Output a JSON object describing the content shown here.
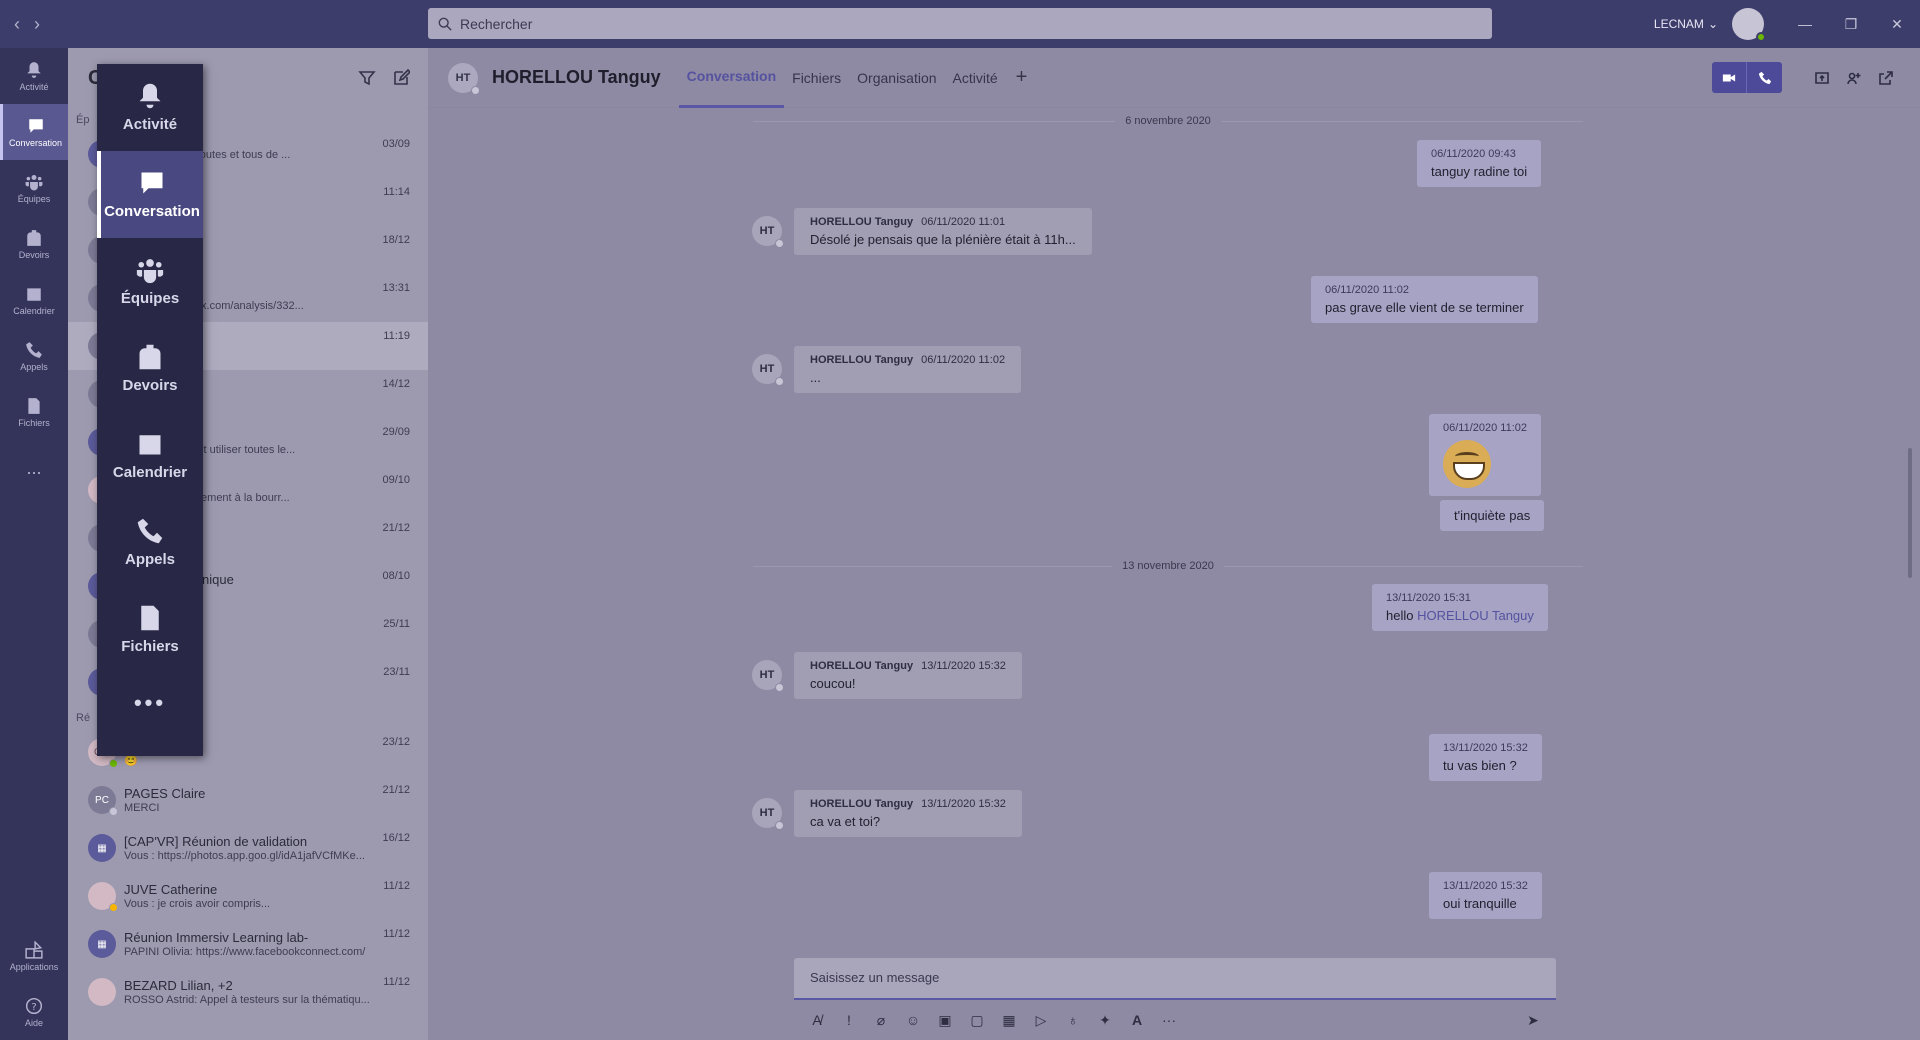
{
  "titlebar": {
    "search_placeholder": "Rechercher",
    "org_name": "LECNAM"
  },
  "rail": {
    "items": [
      {
        "label": "Activité",
        "icon": "bell-icon"
      },
      {
        "label": "Conversation",
        "icon": "chat-icon"
      },
      {
        "label": "Équipes",
        "icon": "teams-icon"
      },
      {
        "label": "Devoirs",
        "icon": "backpack-icon"
      },
      {
        "label": "Calendrier",
        "icon": "calendar-icon"
      },
      {
        "label": "Appels",
        "icon": "phone-icon"
      },
      {
        "label": "Fichiers",
        "icon": "file-icon"
      }
    ],
    "more": "...",
    "apps_label": "Applications",
    "help_label": "Aide"
  },
  "overlay_nav": {
    "items": [
      {
        "label": "Activité",
        "icon": "bell-icon"
      },
      {
        "label": "Conversation",
        "icon": "chat-icon"
      },
      {
        "label": "Équipes",
        "icon": "teams-icon"
      },
      {
        "label": "Devoirs",
        "icon": "backpack-icon"
      },
      {
        "label": "Calendrier",
        "icon": "calendar-icon"
      },
      {
        "label": "Appels",
        "icon": "phone-icon"
      },
      {
        "label": "Fichiers",
        "icon": "file-icon"
      }
    ],
    "more": "•••"
  },
  "chatlist": {
    "header_title": "C",
    "section_pinned": "Ép",
    "section_recent": "Ré",
    "chats": [
      {
        "initials": "",
        "name": "",
        "preview": "hierry: Merci à toutes et tous de ...",
        "time": "03/09"
      },
      {
        "initials": "",
        "name": "ple",
        "preview": "",
        "time": "11:14"
      },
      {
        "initials": "",
        "name": "Vincent",
        "preview": "",
        "time": "18/12"
      },
      {
        "initials": "",
        "name": "; Thierry",
        "preview": "www.joesandbox.com/analysis/332...",
        "time": "13:31"
      },
      {
        "initials": "H",
        "name": "anguy",
        "preview": "a toi aussi!! 😊",
        "time": "11:19"
      },
      {
        "initials": "",
        "name": "ophie",
        "preview": "",
        "time": "14/12"
      },
      {
        "initials": "",
        "name": "R",
        "preview": "hierry: Si on veut utiliser toutes le...",
        "time": "29/09"
      },
      {
        "initials": "B",
        "name": "yriam, +2",
        "preview": "je serai complètement à la bourr...",
        "time": "09/10"
      },
      {
        "initials": "",
        "name": "",
        "preview": "",
        "time": "21/12"
      },
      {
        "initials": "",
        "name": "ocument technique",
        "preview": "ré ajouté",
        "time": "08/10"
      },
      {
        "initials": "",
        "name": "am",
        "preview": "",
        "time": "25/11"
      },
      {
        "initials": "",
        "name": "",
        "preview": "",
        "time": "23/11"
      }
    ],
    "recent": [
      {
        "initials": "GM",
        "name": "GHEZA Marc",
        "preview": "😊",
        "time": "23/12"
      },
      {
        "initials": "PC",
        "name": "PAGES Claire",
        "preview": "MERCI",
        "time": "21/12"
      },
      {
        "initials": "",
        "name": "[CAP'VR] Réunion de validation",
        "preview": "Vous : https://photos.app.goo.gl/idA1jafVCfMKe...",
        "time": "16/12"
      },
      {
        "initials": "",
        "name": "JUVE Catherine",
        "preview": "Vous : je crois avoir compris...",
        "time": "11/12"
      },
      {
        "initials": "",
        "name": "Réunion Immersiv Learning lab-",
        "preview": "PAPINI Olivia: https://www.facebookconnect.com/",
        "time": "11/12"
      },
      {
        "initials": "",
        "name": "BEZARD Lilian, +2",
        "preview": "ROSSO Astrid: Appel à testeurs sur la thématiqu...",
        "time": "11/12"
      }
    ]
  },
  "main": {
    "avatar_initials": "HT",
    "contact_name": "HORELLOU Tanguy",
    "tabs": [
      "Conversation",
      "Fichiers",
      "Organisation",
      "Activité"
    ],
    "tab_add": "+",
    "date_separators": [
      "6 novembre 2020",
      "13 novembre 2020"
    ],
    "messages": [
      {
        "from": "me",
        "meta": "06/11/2020 09:43",
        "body": "tanguy radine toi"
      },
      {
        "from": "other",
        "author": "HORELLOU Tanguy",
        "meta": "06/11/2020 11:01",
        "body": "Désolé je pensais que la plénière était à 11h..."
      },
      {
        "from": "me",
        "meta": "06/11/2020 11:02",
        "body": "pas grave elle vient de se terminer"
      },
      {
        "from": "other",
        "author": "HORELLOU Tanguy",
        "meta": "06/11/2020 11:02",
        "body": "..."
      },
      {
        "from": "me",
        "meta": "06/11/2020 11:02",
        "body": ""
      },
      {
        "from": "me",
        "meta": "",
        "body": "t'inquiète pas"
      },
      {
        "from": "me",
        "meta": "13/11/2020 15:31",
        "body": "hello ",
        "mention": "HORELLOU Tanguy"
      },
      {
        "from": "other",
        "author": "HORELLOU Tanguy",
        "meta": "13/11/2020 15:32",
        "body": "coucou!"
      },
      {
        "from": "me",
        "meta": "13/11/2020 15:32",
        "body": "tu vas bien ?"
      },
      {
        "from": "other",
        "author": "HORELLOU Tanguy",
        "meta": "13/11/2020 15:32",
        "body": "ca va et toi?"
      },
      {
        "from": "me",
        "meta": "13/11/2020 15:32",
        "body": "oui tranquille"
      }
    ],
    "compose_placeholder": "Saisissez un message"
  }
}
